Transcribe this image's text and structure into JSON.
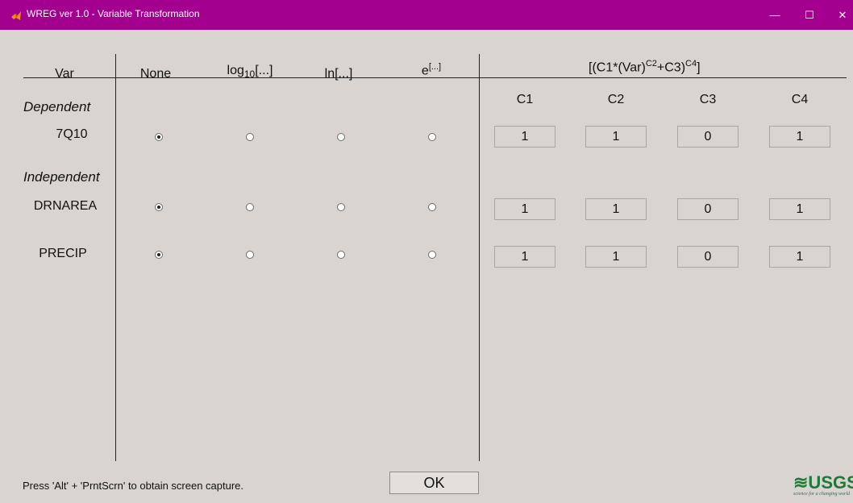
{
  "window": {
    "title": "WREG ver 1.0 - Variable Transformation",
    "minimize": "—",
    "maximize": "☐",
    "close": "✕"
  },
  "headers": {
    "var": "Var",
    "none": "None",
    "log10_base": "log",
    "log10_sub": "10",
    "log10_tail": "[...]",
    "ln": "ln[...]",
    "exp_base": "e",
    "exp_sup": "[...]",
    "formula_a": "[(C1*(Var)",
    "formula_sup1": "C2",
    "formula_b": "+C3)",
    "formula_sup2": "C4",
    "formula_c": "]"
  },
  "columns": [
    "C1",
    "C2",
    "C3",
    "C4"
  ],
  "sections": {
    "dependent": "Dependent",
    "independent": "Independent"
  },
  "rows": [
    {
      "name": "7Q10",
      "selected": "None",
      "c": [
        "1",
        "1",
        "0",
        "1"
      ]
    },
    {
      "name": "DRNAREA",
      "selected": "None",
      "c": [
        "1",
        "1",
        "0",
        "1"
      ]
    },
    {
      "name": "PRECIP",
      "selected": "None",
      "c": [
        "1",
        "1",
        "0",
        "1"
      ]
    }
  ],
  "status_text": "Press 'Alt' + 'PrntScrn' to obtain screen capture.",
  "ok_label": "OK",
  "logo": {
    "text": "≋USGS",
    "tagline": "science for a changing world",
    "color": "#1f7a3a"
  },
  "colors": {
    "titlebar": "#a4008f",
    "background": "#d9d4cf"
  },
  "icons": {
    "app": "matlab-icon",
    "minimize": "minimize-icon",
    "maximize": "maximize-icon",
    "close": "close-icon"
  }
}
